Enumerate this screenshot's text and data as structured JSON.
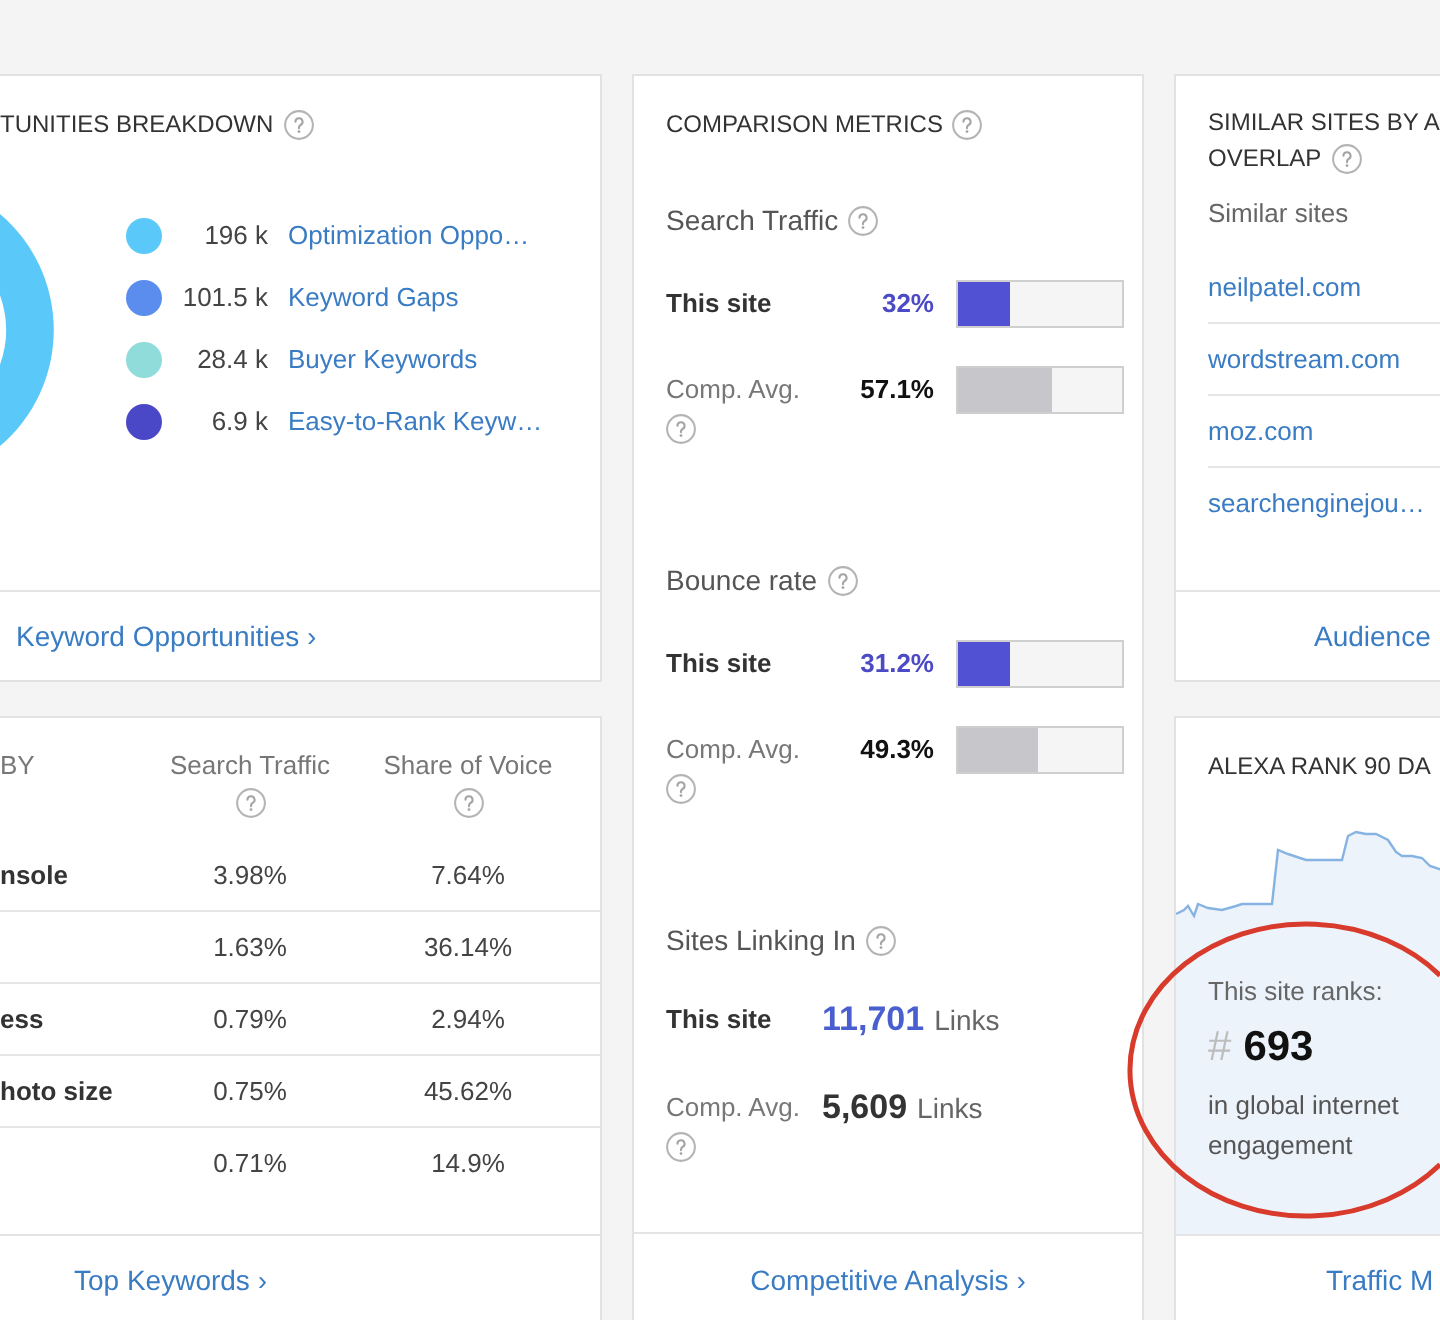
{
  "opportunities_card": {
    "title": "TUNITIES BREAKDOWN",
    "help": true,
    "legend": [
      {
        "value": "196 k",
        "label": "Optimization Oppo…",
        "color": "#5ac8f8"
      },
      {
        "value": "101.5 k",
        "label": "Keyword Gaps",
        "color": "#5b8def"
      },
      {
        "value": "28.4 k",
        "label": "Buyer Keywords",
        "color": "#8fdcdb"
      },
      {
        "value": "6.9 k",
        "label": "Easy-to-Rank Keyw…",
        "color": "#4b48c8"
      }
    ],
    "footer_link": "Keyword Opportunities ›"
  },
  "keywords_card": {
    "columns": [
      {
        "label": "BY",
        "help": false
      },
      {
        "label": "Search Traffic",
        "help": true
      },
      {
        "label": "Share of Voice",
        "help": true
      }
    ],
    "rows": [
      {
        "column_1": "nsole",
        "search_traffic": "3.98%",
        "share_of_voice": "7.64%"
      },
      {
        "search_traffic": "1.63%",
        "share_of_voice": "36.14%"
      },
      {
        "column_1": "ess",
        "search_traffic": "0.79%",
        "share_of_voice": "2.94%"
      },
      {
        "column_1": "hoto size",
        "search_traffic": "0.75%",
        "share_of_voice": "45.62%"
      },
      {
        "search_traffic": "0.71%",
        "share_of_voice": "14.9%"
      }
    ],
    "footer_link": "Top Keywords ›"
  },
  "comparison_card": {
    "title": "COMPARISON METRICS",
    "help": true,
    "sections": [
      {
        "kind": "bars",
        "title": "Search Traffic",
        "help": true,
        "rows": [
          {
            "kind": "site",
            "label": "This site",
            "help": false,
            "value": "32%",
            "level": 0.32
          },
          {
            "kind": "average",
            "label": "Comp. Avg.",
            "help": true,
            "value": "57.1%",
            "level": 0.571
          }
        ]
      },
      {
        "kind": "bars",
        "title": "Bounce rate",
        "help": true,
        "rows": [
          {
            "kind": "site",
            "label": "This site",
            "help": false,
            "value": "31.2%",
            "level": 0.312
          },
          {
            "kind": "average",
            "label": "Comp. Avg.",
            "help": true,
            "value": "49.3%",
            "level": 0.493
          }
        ]
      },
      {
        "kind": "counts",
        "title": "Sites Linking In",
        "help": true,
        "rows": [
          {
            "kind": "site",
            "label": "This site",
            "help": false,
            "value": "11,701",
            "unit": "Links"
          },
          {
            "kind": "average",
            "label": "Comp. Avg.",
            "help": true,
            "value": "5,609",
            "unit": "Links"
          }
        ]
      }
    ],
    "footer_link": "Competitive Analysis ›"
  },
  "similar_sites_card": {
    "title_lines": [
      "SIMILAR SITES BY A",
      "OVERLAP"
    ],
    "help": true,
    "subtitle": "Similar sites",
    "sites": [
      "neilpatel.com",
      "wordstream.com",
      "moz.com",
      "searchenginejou…"
    ],
    "footer_link": "Audience"
  },
  "alexa_card": {
    "title": "ALEXA RANK 90 DA",
    "rank_label": "This site ranks:",
    "rank_prefix": "#",
    "rank": "693",
    "rank_caption": "in global internet engagement",
    "highlighted": true,
    "footer_link": "Traffic M"
  }
}
